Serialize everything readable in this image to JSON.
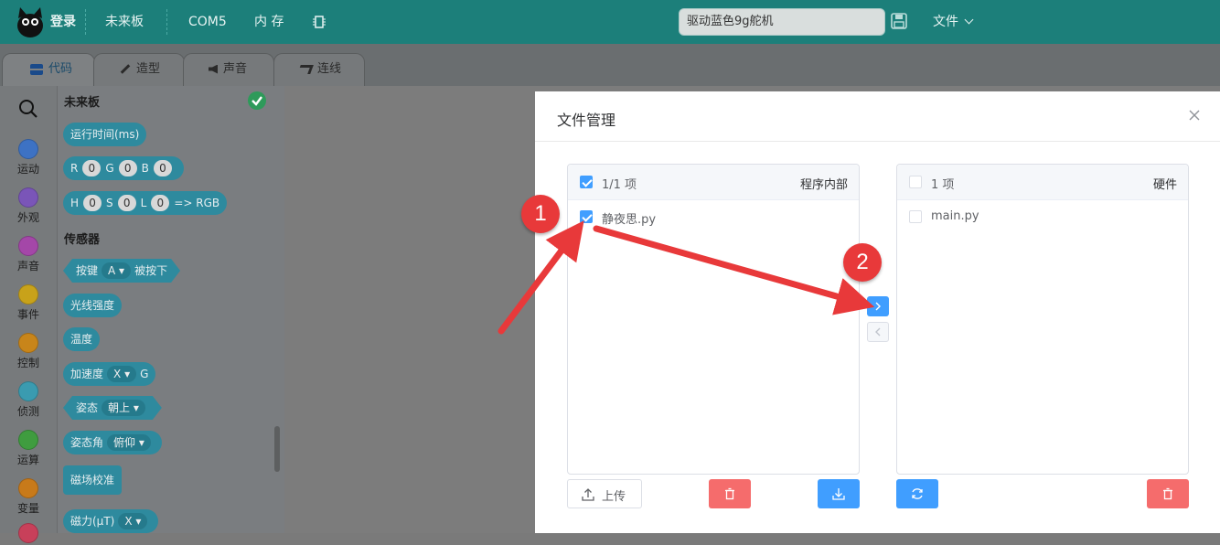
{
  "topbar": {
    "login": "登录",
    "board": "未来板",
    "port": "COM5",
    "memory": "内 存",
    "project_name": "驱动蓝色9g舵机",
    "file_menu": "文件"
  },
  "tabs": [
    {
      "label": "代码",
      "active": true
    },
    {
      "label": "造型",
      "active": false
    },
    {
      "label": "声音",
      "active": false
    },
    {
      "label": "连线",
      "active": false
    }
  ],
  "categories": [
    {
      "label": "运动",
      "color": "#3d72c4"
    },
    {
      "label": "外观",
      "color": "#7a55b8"
    },
    {
      "label": "声音",
      "color": "#a447a8"
    },
    {
      "label": "事件",
      "color": "#c8a21a"
    },
    {
      "label": "控制",
      "color": "#c8851a"
    },
    {
      "label": "侦测",
      "color": "#3a9bb0"
    },
    {
      "label": "运算",
      "color": "#3f9c3f"
    },
    {
      "label": "变量",
      "color": "#c87a1a"
    }
  ],
  "flyout": {
    "section1": "未来板",
    "runtime": "运行时间(ms)",
    "rgb_r": "R",
    "rgb_g": "G",
    "rgb_b": "B",
    "zero": "0",
    "hsl_h": "H",
    "hsl_s": "S",
    "hsl_l": "L",
    "to_rgb": "=> RGB",
    "section2": "传感器",
    "key": "按键",
    "key_val": "A",
    "pressed": "被按下",
    "light": "光线强度",
    "temp": "温度",
    "accel": "加速度",
    "accel_axis": "X",
    "accel_unit": "G",
    "posture": "姿态",
    "posture_val": "朝上",
    "posture_angle": "姿态角",
    "posture_angle_val": "俯仰",
    "mag_cal": "磁场校准",
    "mag": "磁力(μT)",
    "mag_axis": "X"
  },
  "dialog": {
    "title": "文件管理",
    "left_panel": {
      "count": "1/1 项",
      "header": "程序内部",
      "items": [
        "静夜思.py"
      ],
      "upload": "上传"
    },
    "right_panel": {
      "count": "1 项",
      "header": "硬件",
      "items": [
        "main.py"
      ]
    }
  },
  "annotations": [
    "1",
    "2"
  ]
}
